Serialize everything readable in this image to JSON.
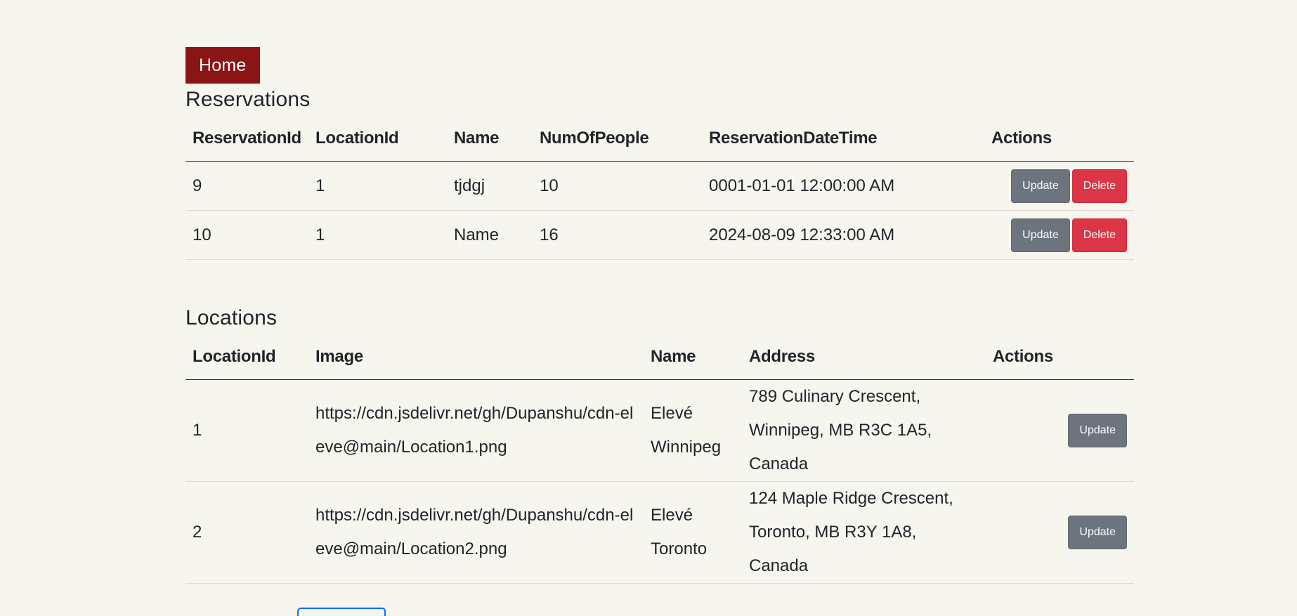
{
  "nav": {
    "home_label": "Home"
  },
  "reservations": {
    "title": "Reservations",
    "columns": [
      "ReservationId",
      "LocationId",
      "Name",
      "NumOfPeople",
      "ReservationDateTime",
      "Actions"
    ],
    "rows": [
      {
        "reservation_id": "9",
        "location_id": "1",
        "name": "tjdgj",
        "num_of_people": "10",
        "date_time": "0001-01-01 12:00:00 AM",
        "update_label": "Update",
        "delete_label": "Delete"
      },
      {
        "reservation_id": "10",
        "location_id": "1",
        "name": "Name",
        "num_of_people": "16",
        "date_time": "2024-08-09 12:33:00 AM",
        "update_label": "Update",
        "delete_label": "Delete"
      }
    ]
  },
  "locations": {
    "title": "Locations",
    "columns": [
      "LocationId",
      "Image",
      "Name",
      "Address",
      "Actions"
    ],
    "rows": [
      {
        "location_id": "1",
        "image": "https://cdn.jsdelivr.net/gh/Dupanshu/cdn-eleve@main/Location1.png",
        "name": "Elevé Winnipeg",
        "address": "789 Culinary Crescent, Winnipeg, MB R3C 1A5, Canada",
        "update_label": "Update"
      },
      {
        "location_id": "2",
        "image": "https://cdn.jsdelivr.net/gh/Dupanshu/cdn-eleve@main/Location2.png",
        "name": "Elevé Toronto",
        "address": "124 Maple Ridge Crescent, Toronto, MB R3Y 1A8, Canada",
        "update_label": "Update"
      }
    ]
  },
  "colors": {
    "background": "#f6f5ee",
    "home_button": "#8b1414",
    "update_button": "#6c757d",
    "delete_button": "#dc3545"
  }
}
